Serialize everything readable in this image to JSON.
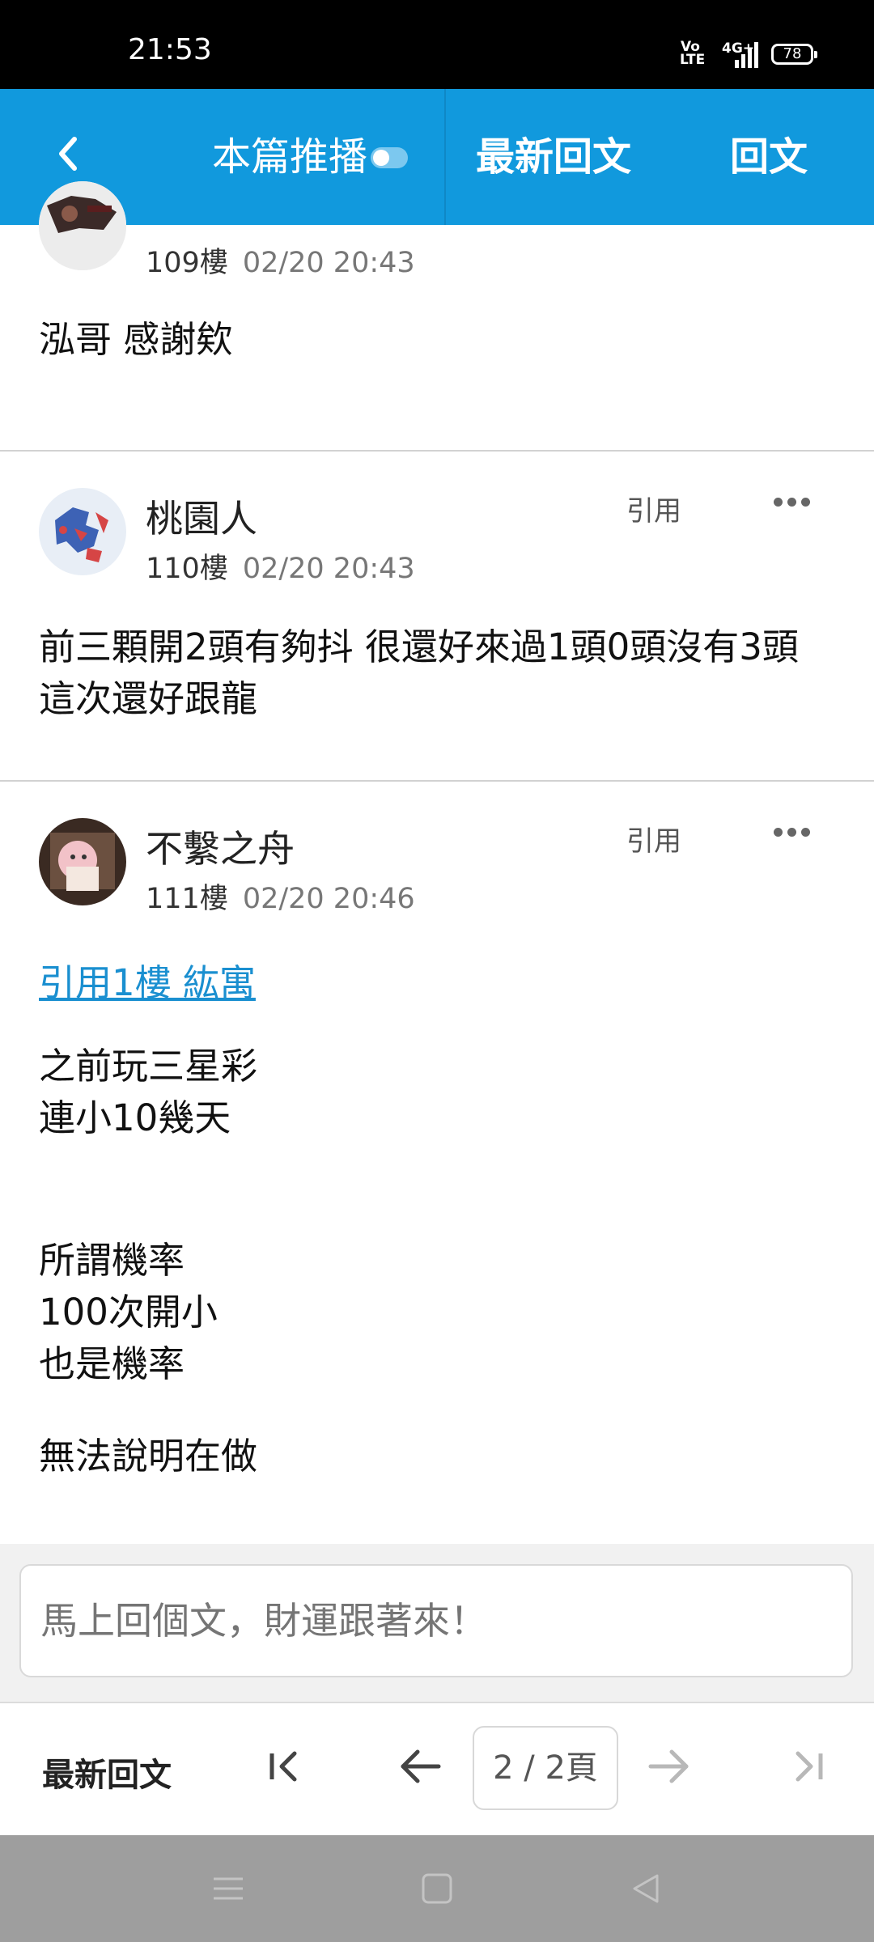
{
  "status_bar": {
    "time": "21:53",
    "volte": "Vo LTE",
    "network": "4G+",
    "battery": "78"
  },
  "top_nav": {
    "push_label": "本篇推播",
    "latest_label": "最新回文",
    "reply_label": "回文"
  },
  "posts": [
    {
      "floor": "109樓",
      "time": "02/20 20:43",
      "content": "泓哥 感謝欸"
    },
    {
      "username": "桃園人",
      "floor": "110樓",
      "time": "02/20 20:43",
      "quote_label": "引用",
      "content": "前三顆開2頭有夠抖 很還好來過1頭0頭沒有3頭\n這次還好跟龍"
    },
    {
      "username": "不繫之舟",
      "floor": "111樓",
      "time": "02/20 20:46",
      "quote_label": "引用",
      "quote_link": "引用1樓 紘寓",
      "content_a": "之前玩三星彩\n連小10幾天",
      "content_b": "所謂機率\n100次開小\n也是機率",
      "content_c": "無法說明在做"
    }
  ],
  "reply_box": {
    "placeholder": "馬上回個文，財運跟著來！"
  },
  "pager": {
    "latest_label": "最新回文",
    "page_indicator": "2 / 2頁"
  },
  "icons": {
    "back": "chevron-left-icon",
    "more": "more-dots-icon",
    "first": "first-page-icon",
    "prev": "arrow-left-icon",
    "next": "arrow-right-icon",
    "last": "last-page-icon",
    "menu": "menu-icon",
    "home": "home-icon",
    "system_back": "triangle-back-icon"
  },
  "colors": {
    "brand": "#1199dd",
    "link": "#1a8fd0",
    "disabled": "#b8b8b8"
  }
}
